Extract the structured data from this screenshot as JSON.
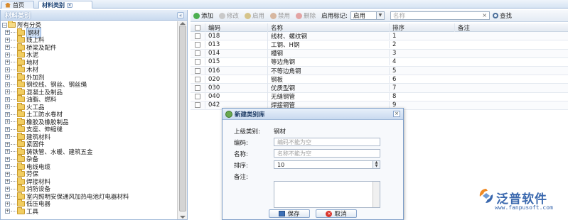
{
  "tabs": [
    {
      "label": "首页",
      "icon": "home-icon"
    },
    {
      "label": "材料类别",
      "icon": "close-icon",
      "active": true
    }
  ],
  "left_panel": {
    "title": "材料类别",
    "collapse_label": "«",
    "root": "所有分类",
    "items": [
      "钢材",
      "线上料",
      "桥梁及配件",
      "水泥",
      "地材",
      "木材",
      "外加剂",
      "钢绞线、钢丝、钢丝绳",
      "混凝土及制品",
      "油脂、燃料",
      "火工品",
      "土工防水卷材",
      "橡胶及橡胶制品",
      "支座、伸缩缝",
      "建筑材料",
      "紧固件",
      "铸铁管、水暖、建筑五金",
      "杂备",
      "电线电缆",
      "劳保",
      "焊接材料",
      "消防设备",
      "室内照明安保通风加热电池灯电器材料",
      "低压电器",
      "工具"
    ]
  },
  "toolbar": {
    "add": "添加",
    "edit": "修改",
    "enable": "启用",
    "disable": "禁用",
    "delete": "删除",
    "enable_flag_label": "启用标记:",
    "enable_flag_value": "启用",
    "search_placeholder": "名称",
    "search_button": "查找"
  },
  "grid": {
    "columns": [
      "编码",
      "名称",
      "排序",
      "备注"
    ],
    "rows": [
      {
        "code": "018",
        "name": "线材、螺纹钢",
        "sort": "1",
        "note": ""
      },
      {
        "code": "013",
        "name": "工钢、H钢",
        "sort": "2",
        "note": ""
      },
      {
        "code": "014",
        "name": "槽钢",
        "sort": "3",
        "note": ""
      },
      {
        "code": "015",
        "name": "等边角钢",
        "sort": "4",
        "note": ""
      },
      {
        "code": "016",
        "name": "不等边角钢",
        "sort": "5",
        "note": ""
      },
      {
        "code": "020",
        "name": "钢板",
        "sort": "6",
        "note": ""
      },
      {
        "code": "030",
        "name": "优质型钢",
        "sort": "7",
        "note": ""
      },
      {
        "code": "040",
        "name": "无缝钢管",
        "sort": "8",
        "note": ""
      },
      {
        "code": "042",
        "name": "焊接钢管",
        "sort": "9",
        "note": ""
      }
    ]
  },
  "modal": {
    "title": "新建类别库",
    "parent_label": "上级类别:",
    "parent_value": "钢材",
    "code_label": "编码:",
    "code_placeholder": "编码不能为空",
    "name_label": "名称:",
    "name_placeholder": "名称不能为空",
    "sort_label": "排序:",
    "sort_value": "10",
    "note_label": "备注:",
    "save": "保存",
    "cancel": "取消"
  },
  "logo": {
    "text": "泛普软件",
    "url": "www.fanpusoft.com"
  },
  "colors": {
    "accent": "#3a68ae",
    "header_bg": "#c9daef",
    "selected": "#cfe0f6"
  }
}
